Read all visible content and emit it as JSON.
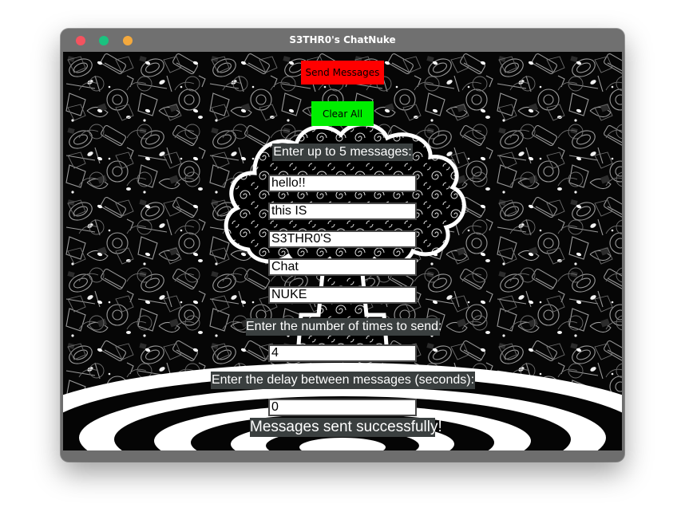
{
  "window": {
    "title": "S3THR0's ChatNuke"
  },
  "buttons": {
    "send_label": "Send Messages",
    "clear_label": "Clear All"
  },
  "labels": {
    "messages": "Enter up to 5 messages:",
    "times": "Enter the number of times to send:",
    "delay": "Enter the delay between messages (seconds):",
    "status": "Messages sent successfully!"
  },
  "fields": {
    "messages": [
      "hello!!",
      "this IS",
      "S3THR0'S",
      "Chat",
      "NUKE"
    ],
    "times": "4",
    "delay": "0"
  },
  "colors": {
    "send_button": "#ff0000",
    "clear_button": "#00ee00",
    "label_background": "#3a3f3f",
    "titlebar": "#707070"
  }
}
